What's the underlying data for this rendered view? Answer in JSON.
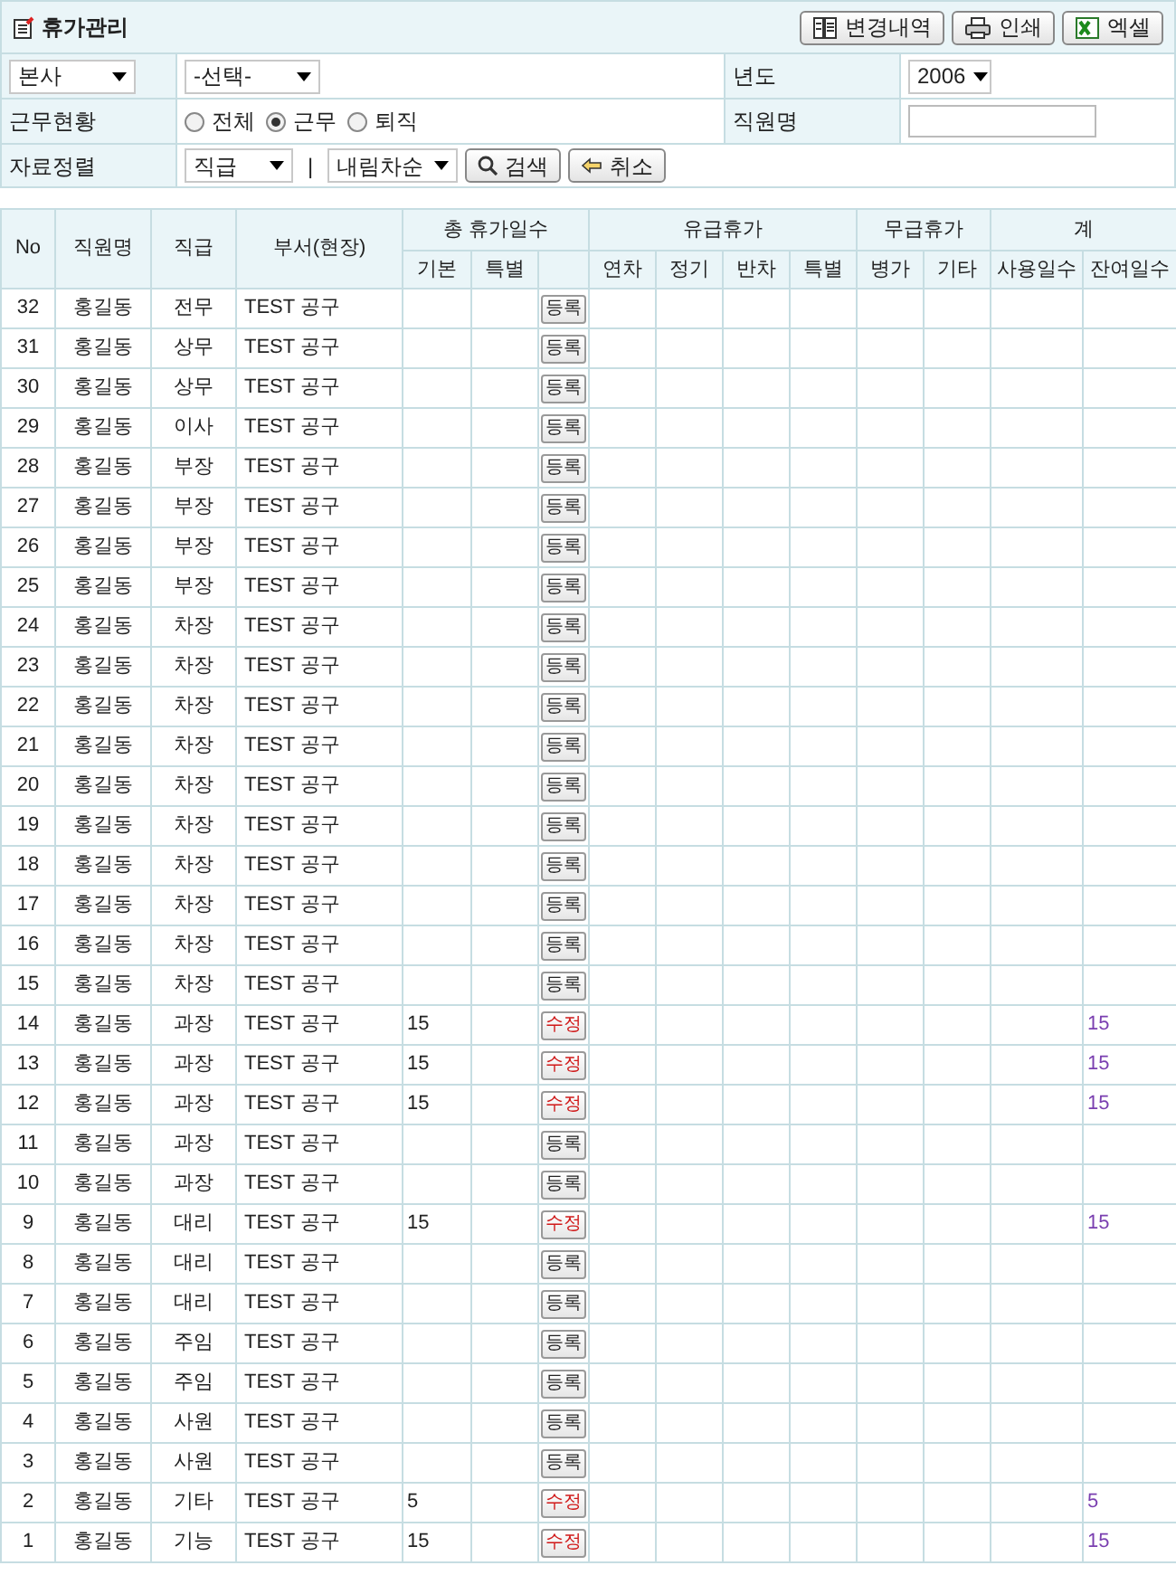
{
  "title": "휴가관리",
  "toolbar_buttons": [
    {
      "kind": "history",
      "label": "변경내역"
    },
    {
      "kind": "print",
      "label": "인쇄"
    },
    {
      "kind": "excel",
      "label": "엑셀"
    }
  ],
  "filters": {
    "company": {
      "value": "본사"
    },
    "department": {
      "value": "-선택-"
    },
    "year_label": "년도",
    "year": {
      "value": "2006"
    },
    "status_label": "근무현황",
    "status_options": [
      {
        "label": "전체",
        "selected": false
      },
      {
        "label": "근무",
        "selected": true
      },
      {
        "label": "퇴직",
        "selected": false
      }
    ],
    "name_label": "직원명",
    "sort_label": "자료정렬",
    "sort_field": {
      "value": "직급"
    },
    "separator": "|",
    "sort_order": {
      "value": "내림차순"
    },
    "search_button": "검색",
    "cancel_button": "취소"
  },
  "table": {
    "columns": [
      "No",
      "직원명",
      "직급",
      "부서(현장)"
    ],
    "groups": [
      {
        "label": "총 휴가일수",
        "sub": [
          "기본",
          "특별"
        ]
      },
      {
        "label": "유급휴가",
        "sub": [
          "연차",
          "정기",
          "반차",
          "특별"
        ]
      },
      {
        "label": "무급휴가",
        "sub": [
          "병가",
          "기타"
        ]
      },
      {
        "label": "계",
        "sub": [
          "사용일수",
          "잔여일수"
        ]
      }
    ],
    "rows": [
      {
        "no": "32",
        "name": "홍길동",
        "rank": "전무",
        "dept": "TEST 공구",
        "action": {
          "kind": "register",
          "label": "등록"
        }
      },
      {
        "no": "31",
        "name": "홍길동",
        "rank": "상무",
        "dept": "TEST 공구",
        "action": {
          "kind": "register",
          "label": "등록"
        }
      },
      {
        "no": "30",
        "name": "홍길동",
        "rank": "상무",
        "dept": "TEST 공구",
        "action": {
          "kind": "register",
          "label": "등록"
        }
      },
      {
        "no": "29",
        "name": "홍길동",
        "rank": "이사",
        "dept": "TEST 공구",
        "action": {
          "kind": "register",
          "label": "등록"
        }
      },
      {
        "no": "28",
        "name": "홍길동",
        "rank": "부장",
        "dept": "TEST 공구",
        "action": {
          "kind": "register",
          "label": "등록"
        }
      },
      {
        "no": "27",
        "name": "홍길동",
        "rank": "부장",
        "dept": "TEST 공구",
        "action": {
          "kind": "register",
          "label": "등록"
        }
      },
      {
        "no": "26",
        "name": "홍길동",
        "rank": "부장",
        "dept": "TEST 공구",
        "action": {
          "kind": "register",
          "label": "등록"
        }
      },
      {
        "no": "25",
        "name": "홍길동",
        "rank": "부장",
        "dept": "TEST 공구",
        "action": {
          "kind": "register",
          "label": "등록"
        }
      },
      {
        "no": "24",
        "name": "홍길동",
        "rank": "차장",
        "dept": "TEST 공구",
        "action": {
          "kind": "register",
          "label": "등록"
        }
      },
      {
        "no": "23",
        "name": "홍길동",
        "rank": "차장",
        "dept": "TEST 공구",
        "action": {
          "kind": "register",
          "label": "등록"
        }
      },
      {
        "no": "22",
        "name": "홍길동",
        "rank": "차장",
        "dept": "TEST 공구",
        "action": {
          "kind": "register",
          "label": "등록"
        }
      },
      {
        "no": "21",
        "name": "홍길동",
        "rank": "차장",
        "dept": "TEST 공구",
        "action": {
          "kind": "register",
          "label": "등록"
        }
      },
      {
        "no": "20",
        "name": "홍길동",
        "rank": "차장",
        "dept": "TEST 공구",
        "action": {
          "kind": "register",
          "label": "등록"
        }
      },
      {
        "no": "19",
        "name": "홍길동",
        "rank": "차장",
        "dept": "TEST 공구",
        "action": {
          "kind": "register",
          "label": "등록"
        }
      },
      {
        "no": "18",
        "name": "홍길동",
        "rank": "차장",
        "dept": "TEST 공구",
        "action": {
          "kind": "register",
          "label": "등록"
        }
      },
      {
        "no": "17",
        "name": "홍길동",
        "rank": "차장",
        "dept": "TEST 공구",
        "action": {
          "kind": "register",
          "label": "등록"
        }
      },
      {
        "no": "16",
        "name": "홍길동",
        "rank": "차장",
        "dept": "TEST 공구",
        "action": {
          "kind": "register",
          "label": "등록"
        }
      },
      {
        "no": "15",
        "name": "홍길동",
        "rank": "차장",
        "dept": "TEST 공구",
        "action": {
          "kind": "register",
          "label": "등록"
        }
      },
      {
        "no": "14",
        "name": "홍길동",
        "rank": "과장",
        "dept": "TEST 공구",
        "basic": "15",
        "action": {
          "kind": "edit",
          "label": "수정"
        },
        "remaining": "15"
      },
      {
        "no": "13",
        "name": "홍길동",
        "rank": "과장",
        "dept": "TEST 공구",
        "basic": "15",
        "action": {
          "kind": "edit",
          "label": "수정"
        },
        "remaining": "15"
      },
      {
        "no": "12",
        "name": "홍길동",
        "rank": "과장",
        "dept": "TEST 공구",
        "basic": "15",
        "action": {
          "kind": "edit",
          "label": "수정"
        },
        "remaining": "15"
      },
      {
        "no": "11",
        "name": "홍길동",
        "rank": "과장",
        "dept": "TEST 공구",
        "action": {
          "kind": "register",
          "label": "등록"
        }
      },
      {
        "no": "10",
        "name": "홍길동",
        "rank": "과장",
        "dept": "TEST 공구",
        "action": {
          "kind": "register",
          "label": "등록"
        }
      },
      {
        "no": "9",
        "name": "홍길동",
        "rank": "대리",
        "dept": "TEST 공구",
        "basic": "15",
        "action": {
          "kind": "edit",
          "label": "수정"
        },
        "remaining": "15"
      },
      {
        "no": "8",
        "name": "홍길동",
        "rank": "대리",
        "dept": "TEST 공구",
        "action": {
          "kind": "register",
          "label": "등록"
        }
      },
      {
        "no": "7",
        "name": "홍길동",
        "rank": "대리",
        "dept": "TEST 공구",
        "action": {
          "kind": "register",
          "label": "등록"
        }
      },
      {
        "no": "6",
        "name": "홍길동",
        "rank": "주임",
        "dept": "TEST 공구",
        "action": {
          "kind": "register",
          "label": "등록"
        }
      },
      {
        "no": "5",
        "name": "홍길동",
        "rank": "주임",
        "dept": "TEST 공구",
        "action": {
          "kind": "register",
          "label": "등록"
        }
      },
      {
        "no": "4",
        "name": "홍길동",
        "rank": "사원",
        "dept": "TEST 공구",
        "action": {
          "kind": "register",
          "label": "등록"
        }
      },
      {
        "no": "3",
        "name": "홍길동",
        "rank": "사원",
        "dept": "TEST 공구",
        "action": {
          "kind": "register",
          "label": "등록"
        }
      },
      {
        "no": "2",
        "name": "홍길동",
        "rank": "기타",
        "dept": "TEST 공구",
        "basic": "5",
        "action": {
          "kind": "edit",
          "label": "수정"
        },
        "remaining": "5"
      },
      {
        "no": "1",
        "name": "홍길동",
        "rank": "기능",
        "dept": "TEST 공구",
        "basic": "15",
        "action": {
          "kind": "edit",
          "label": "수정"
        },
        "remaining": "15"
      }
    ]
  }
}
